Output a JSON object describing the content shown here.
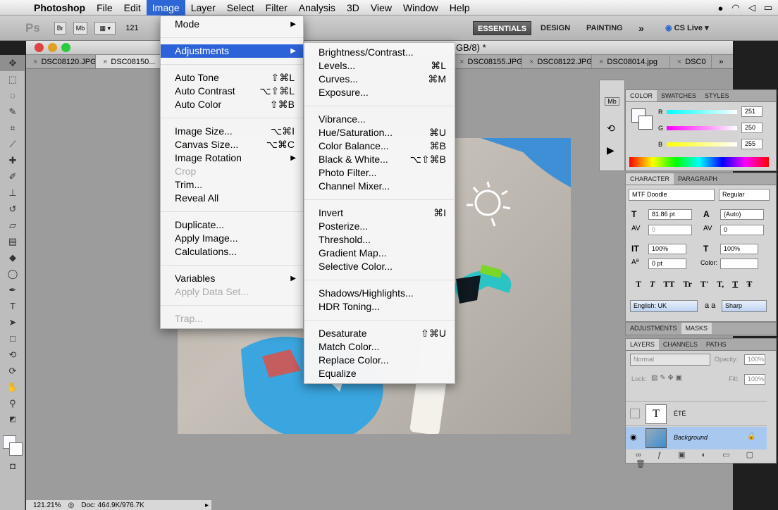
{
  "menubar": {
    "app": "Photoshop",
    "items": [
      "File",
      "Edit",
      "Image",
      "Layer",
      "Select",
      "Filter",
      "Analysis",
      "3D",
      "View",
      "Window",
      "Help"
    ]
  },
  "options": {
    "ps_label": "Ps",
    "br": "Br",
    "mb": "Mb",
    "zoom": "121",
    "workspaces": [
      "ESSENTIALS",
      "DESIGN",
      "PAINTING"
    ],
    "more": "»",
    "cslive": "CS Live"
  },
  "document": {
    "title_suffix": "GB/8) *",
    "tabs": [
      "DSC08120.JPG",
      "DSC08150...",
      "DSC08155.JPG",
      "DSC08122.JPG",
      "DSC08014.jpg",
      "DSC0"
    ],
    "tabs_more": "»"
  },
  "image_menu": [
    {
      "label": "Mode",
      "arrow": true
    },
    {
      "sep": true
    },
    {
      "label": "Adjustments",
      "arrow": true,
      "highlight": true
    },
    {
      "sep": true
    },
    {
      "label": "Auto Tone",
      "shortcut": "⇧⌘L"
    },
    {
      "label": "Auto Contrast",
      "shortcut": "⌥⇧⌘L"
    },
    {
      "label": "Auto Color",
      "shortcut": "⇧⌘B"
    },
    {
      "sep": true
    },
    {
      "label": "Image Size...",
      "shortcut": "⌥⌘I"
    },
    {
      "label": "Canvas Size...",
      "shortcut": "⌥⌘C"
    },
    {
      "label": "Image Rotation",
      "arrow": true
    },
    {
      "label": "Crop",
      "disabled": true
    },
    {
      "label": "Trim..."
    },
    {
      "label": "Reveal All"
    },
    {
      "sep": true
    },
    {
      "label": "Duplicate..."
    },
    {
      "label": "Apply Image..."
    },
    {
      "label": "Calculations..."
    },
    {
      "sep": true
    },
    {
      "label": "Variables",
      "arrow": true
    },
    {
      "label": "Apply Data Set...",
      "disabled": true
    },
    {
      "sep": true
    },
    {
      "label": "Trap...",
      "disabled": true
    }
  ],
  "adjustments_menu": [
    {
      "label": "Brightness/Contrast..."
    },
    {
      "label": "Levels...",
      "shortcut": "⌘L"
    },
    {
      "label": "Curves...",
      "shortcut": "⌘M"
    },
    {
      "label": "Exposure..."
    },
    {
      "sep": true
    },
    {
      "label": "Vibrance..."
    },
    {
      "label": "Hue/Saturation...",
      "shortcut": "⌘U"
    },
    {
      "label": "Color Balance...",
      "shortcut": "⌘B"
    },
    {
      "label": "Black & White...",
      "shortcut": "⌥⇧⌘B"
    },
    {
      "label": "Photo Filter..."
    },
    {
      "label": "Channel Mixer..."
    },
    {
      "sep": true
    },
    {
      "label": "Invert",
      "shortcut": "⌘I"
    },
    {
      "label": "Posterize..."
    },
    {
      "label": "Threshold..."
    },
    {
      "label": "Gradient Map..."
    },
    {
      "label": "Selective Color..."
    },
    {
      "sep": true
    },
    {
      "label": "Shadows/Highlights..."
    },
    {
      "label": "HDR Toning..."
    },
    {
      "sep": true
    },
    {
      "label": "Desaturate",
      "shortcut": "⇧⌘U"
    },
    {
      "label": "Match Color..."
    },
    {
      "label": "Replace Color..."
    },
    {
      "label": "Equalize"
    }
  ],
  "color_panel": {
    "tabs": [
      "COLOR",
      "SWATCHES",
      "STYLES"
    ],
    "channels": [
      {
        "name": "R",
        "value": "251"
      },
      {
        "name": "G",
        "value": "250"
      },
      {
        "name": "B",
        "value": "255"
      }
    ]
  },
  "character_panel": {
    "tabs": [
      "CHARACTER",
      "PARAGRAPH"
    ],
    "font": "MTF Doodle",
    "style": "Regular",
    "size": "81.86 pt",
    "leading": "(Auto)",
    "kerning": "0",
    "tracking": "0",
    "vscale": "100%",
    "hscale": "100%",
    "baseline": "0 pt",
    "color_label": "Color:",
    "language": "English: UK",
    "aa_label": "a a",
    "aa": "Sharp",
    "glyph_buttons": [
      "T",
      "T",
      "TT",
      "Tr",
      "T'",
      "T,",
      "T",
      "Ŧ"
    ]
  },
  "adjust_panel": {
    "tabs": [
      "ADJUSTMENTS",
      "MASKS"
    ]
  },
  "layers_panel": {
    "tabs": [
      "LAYERS",
      "CHANNELS",
      "PATHS"
    ],
    "blend": "Normal",
    "opacity_label": "Opacity:",
    "opacity": "100%",
    "lock_label": "Lock:",
    "fill_label": "Fill:",
    "fill": "100%",
    "layers": [
      {
        "name": "ÉTÉ",
        "kind": "text"
      },
      {
        "name": "Background",
        "kind": "image"
      }
    ]
  },
  "status": {
    "zoom": "121.21%",
    "doc": "Doc: 464.9K/976.7K"
  }
}
